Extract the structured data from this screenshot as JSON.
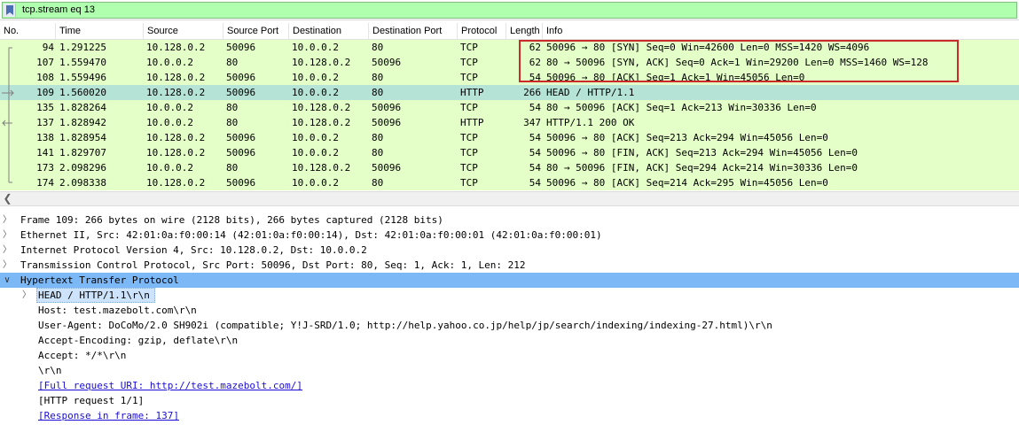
{
  "filter": {
    "value": "tcp.stream eq 13",
    "bookmark_icon": "bookmark-icon",
    "background": "#afffaf"
  },
  "columns": [
    "No.",
    "Time",
    "Source",
    "Source Port",
    "Destination",
    "Destination Port",
    "Protocol",
    "Length",
    "Info"
  ],
  "packets": [
    {
      "no": "94",
      "time": "1.291225",
      "source": "10.128.0.2",
      "sport": "50096",
      "destination": "10.0.0.2",
      "dport": "80",
      "protocol": "TCP",
      "length": "62",
      "info": "50096 → 80 [SYN] Seq=0 Win=42600 Len=0 MSS=1420 WS=4096"
    },
    {
      "no": "107",
      "time": "1.559470",
      "source": "10.0.0.2",
      "sport": "80",
      "destination": "10.128.0.2",
      "dport": "50096",
      "protocol": "TCP",
      "length": "62",
      "info": "80 → 50096 [SYN, ACK] Seq=0 Ack=1 Win=29200 Len=0 MSS=1460 WS=128"
    },
    {
      "no": "108",
      "time": "1.559496",
      "source": "10.128.0.2",
      "sport": "50096",
      "destination": "10.0.0.2",
      "dport": "80",
      "protocol": "TCP",
      "length": "54",
      "info": "50096 → 80 [ACK] Seq=1 Ack=1 Win=45056 Len=0"
    },
    {
      "no": "109",
      "time": "1.560020",
      "source": "10.128.0.2",
      "sport": "50096",
      "destination": "10.0.0.2",
      "dport": "80",
      "protocol": "HTTP",
      "length": "266",
      "info": "HEAD / HTTP/1.1"
    },
    {
      "no": "135",
      "time": "1.828264",
      "source": "10.0.0.2",
      "sport": "80",
      "destination": "10.128.0.2",
      "dport": "50096",
      "protocol": "TCP",
      "length": "54",
      "info": "80 → 50096 [ACK] Seq=1 Ack=213 Win=30336 Len=0"
    },
    {
      "no": "137",
      "time": "1.828942",
      "source": "10.0.0.2",
      "sport": "80",
      "destination": "10.128.0.2",
      "dport": "50096",
      "protocol": "HTTP",
      "length": "347",
      "info": "HTTP/1.1 200 OK"
    },
    {
      "no": "138",
      "time": "1.828954",
      "source": "10.128.0.2",
      "sport": "50096",
      "destination": "10.0.0.2",
      "dport": "80",
      "protocol": "TCP",
      "length": "54",
      "info": "50096 → 80 [ACK] Seq=213 Ack=294 Win=45056 Len=0"
    },
    {
      "no": "141",
      "time": "1.829707",
      "source": "10.128.0.2",
      "sport": "50096",
      "destination": "10.0.0.2",
      "dport": "80",
      "protocol": "TCP",
      "length": "54",
      "info": "50096 → 80 [FIN, ACK] Seq=213 Ack=294 Win=45056 Len=0"
    },
    {
      "no": "173",
      "time": "2.098296",
      "source": "10.0.0.2",
      "sport": "80",
      "destination": "10.128.0.2",
      "dport": "50096",
      "protocol": "TCP",
      "length": "54",
      "info": "80 → 50096 [FIN, ACK] Seq=294 Ack=214 Win=30336 Len=0"
    },
    {
      "no": "174",
      "time": "2.098338",
      "source": "10.128.0.2",
      "sport": "50096",
      "destination": "10.0.0.2",
      "dport": "80",
      "protocol": "TCP",
      "length": "54",
      "info": "50096 → 80 [ACK] Seq=214 Ack=295 Win=45056 Len=0"
    }
  ],
  "selected_packet": "109",
  "colors": {
    "row_tcp": "#e4ffc7",
    "row_selected": "#b5e3d5",
    "detail_highlight": "#7cb7f6",
    "annotation_box": "#cc2929",
    "link": "#1a0dd6"
  },
  "details": {
    "frame": "Frame 109: 266 bytes on wire (2128 bits), 266 bytes captured (2128 bits)",
    "ethernet": "Ethernet II, Src: 42:01:0a:f0:00:14 (42:01:0a:f0:00:14), Dst: 42:01:0a:f0:00:01 (42:01:0a:f0:00:01)",
    "ip": "Internet Protocol Version 4, Src: 10.128.0.2, Dst: 10.0.0.2",
    "tcp": "Transmission Control Protocol, Src Port: 50096, Dst Port: 80, Seq: 1, Ack: 1, Len: 212",
    "http": "Hypertext Transfer Protocol",
    "http_fields": {
      "request_line": "HEAD / HTTP/1.1\\r\\n",
      "host": "Host: test.mazebolt.com\\r\\n",
      "user_agent": "User-Agent: DoCoMo/2.0 SH902i (compatible; Y!J-SRD/1.0; http://help.yahoo.co.jp/help/jp/search/indexing/indexing-27.html)\\r\\n",
      "accept_encoding": "Accept-Encoding: gzip, deflate\\r\\n",
      "accept": "Accept: */*\\r\\n",
      "crlf": "\\r\\n",
      "full_uri": "[Full request URI: http://test.mazebolt.com/]",
      "request_num": "[HTTP request 1/1]",
      "response_in": "[Response in frame: 137]"
    }
  },
  "icons": {
    "expand": "chevron-right-icon",
    "collapse": "chevron-down-icon",
    "scroll_left": "arrow-left-icon"
  }
}
